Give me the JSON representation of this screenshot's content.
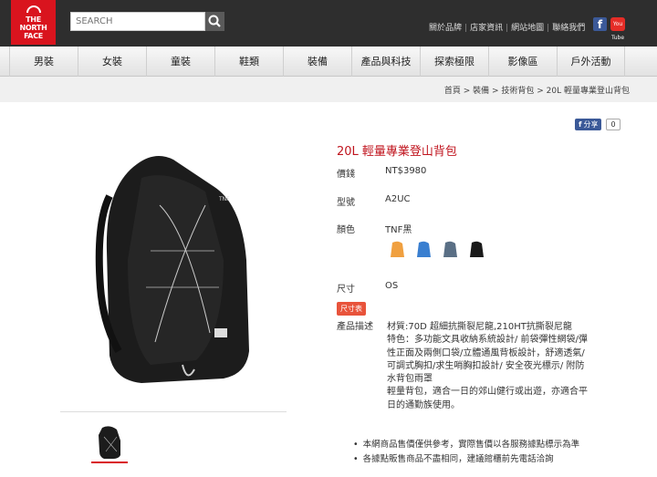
{
  "header": {
    "logo_text": "THE NORTH FACE",
    "search_placeholder": "SEARCH",
    "links": [
      "關於品牌",
      "店家資訊",
      "網站地圖",
      "聯絡我們"
    ],
    "youtube_label": "You Tube"
  },
  "nav": [
    "男裝",
    "女裝",
    "童裝",
    "鞋類",
    "裝備",
    "產品與科技",
    "探索極限",
    "影像區",
    "戶外活動"
  ],
  "breadcrumb": "首頁 > 裝備 > 技術背包 > 20L 輕量專業登山背包",
  "share": {
    "label": "分享",
    "count": "0"
  },
  "product": {
    "title": "20L 輕量專業登山背包",
    "price_label": "價錢",
    "price_value": "NT$3980",
    "model_label": "型號",
    "model_value": "A2UC",
    "color_label": "顏色",
    "color_value": "TNF黑",
    "swatch_colors": [
      "#f0a040",
      "#3a7fd0",
      "#5a6f85",
      "#1a1a1a"
    ],
    "size_label": "尺寸",
    "size_value": "OS",
    "size_chart_button": "尺寸表",
    "desc_label": "產品描述",
    "desc_lines": [
      "材質:70D 超細抗撕裂尼龍,210HT抗撕裂尼龍",
      "特色：多功能文具收納系統設計/ 前袋彈性網袋/彈",
      "性正面及兩側口袋/立體通風背板設計，舒適透氣/",
      "可調式胸扣/求生哨胸扣設計/ 安全夜光標示/ 附防",
      "水背包雨罩",
      "輕量背包，適合一日的郊山健行或出遊，亦適合平",
      "日的通勤族使用。"
    ],
    "notes": [
      "本網商品售價僅供參考，實際售價以各服務據點標示為準",
      "各據點販售商品不盡相同，建議館櫃前先電話洽詢"
    ]
  },
  "colors": {
    "brand_red": "#d9141e",
    "accent_red": "#c0141e",
    "header_bg": "#2e2e2e"
  }
}
